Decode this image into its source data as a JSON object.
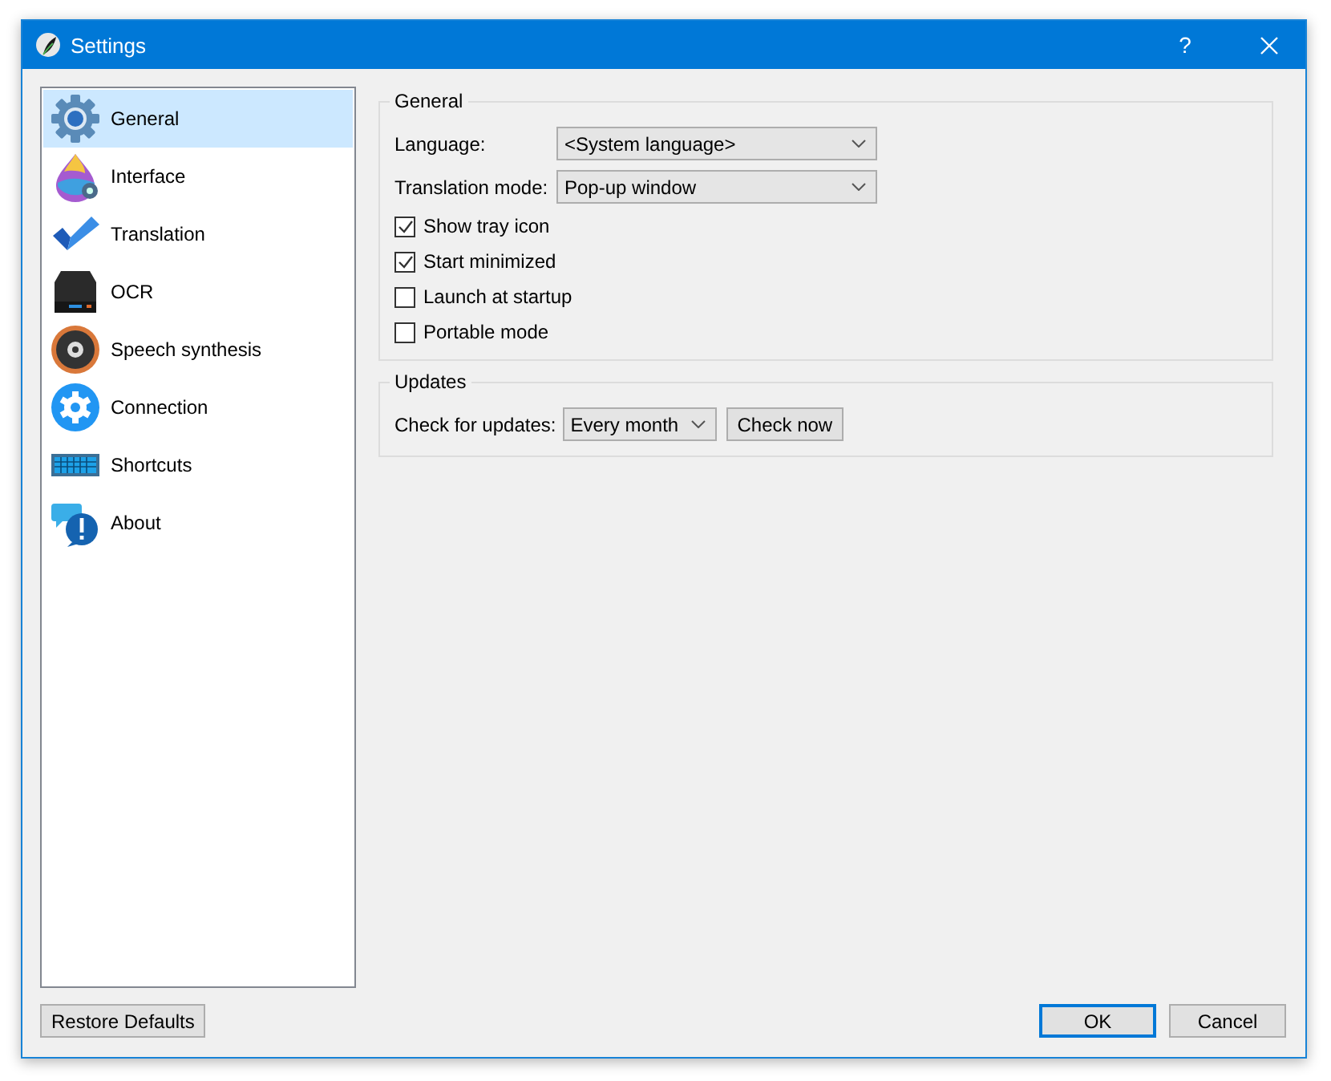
{
  "window": {
    "title": "Settings",
    "help": "?"
  },
  "sidebar": {
    "items": [
      {
        "label": "General",
        "selected": true
      },
      {
        "label": "Interface",
        "selected": false
      },
      {
        "label": "Translation",
        "selected": false
      },
      {
        "label": "OCR",
        "selected": false
      },
      {
        "label": "Speech synthesis",
        "selected": false
      },
      {
        "label": "Connection",
        "selected": false
      },
      {
        "label": "Shortcuts",
        "selected": false
      },
      {
        "label": "About",
        "selected": false
      }
    ]
  },
  "general": {
    "title": "General",
    "fields": [
      {
        "label": "Language:",
        "value": "<System language>"
      },
      {
        "label": "Translation mode:",
        "value": "Pop-up window"
      }
    ],
    "checkboxes": [
      {
        "label": "Show tray icon",
        "checked": true
      },
      {
        "label": "Start minimized",
        "checked": true
      },
      {
        "label": "Launch at startup",
        "checked": false
      },
      {
        "label": "Portable mode",
        "checked": false
      }
    ]
  },
  "updates": {
    "title": "Updates",
    "label": "Check for updates:",
    "value": "Every month",
    "button": "Check now"
  },
  "footer": {
    "restore": "Restore Defaults",
    "buttons": [
      {
        "label": "OK",
        "default": true
      },
      {
        "label": "Cancel",
        "default": false
      }
    ]
  }
}
